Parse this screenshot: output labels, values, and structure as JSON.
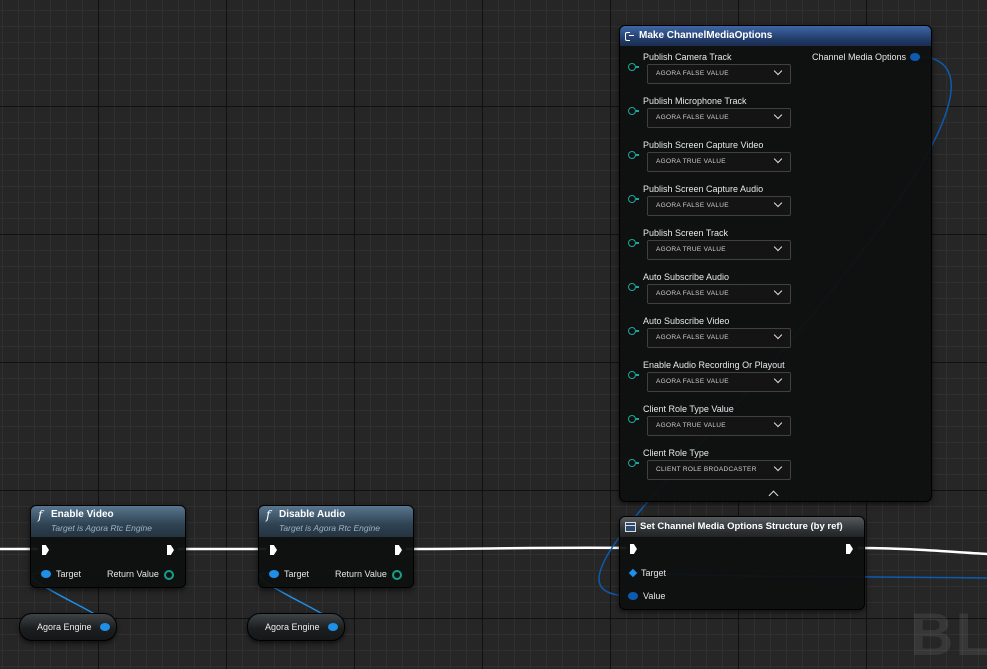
{
  "watermark": "BLU",
  "enable_video": {
    "title": "Enable Video",
    "subtitle": "Target is Agora Rtc Engine",
    "target_label": "Target",
    "return_label": "Return Value"
  },
  "disable_audio": {
    "title": "Disable Audio",
    "subtitle": "Target is Agora Rtc Engine",
    "target_label": "Target",
    "return_label": "Return Value"
  },
  "agora_engine_vars": [
    {
      "label": "Agora Engine"
    },
    {
      "label": "Agora Engine"
    }
  ],
  "make_node": {
    "title": "Make ChannelMediaOptions",
    "output_label": "Channel Media Options",
    "fields": [
      {
        "label": "Publish Camera Track",
        "value": "AGORA FALSE VALUE"
      },
      {
        "label": "Publish Microphone Track",
        "value": "AGORA FALSE VALUE"
      },
      {
        "label": "Publish Screen Capture Video",
        "value": "AGORA TRUE VALUE"
      },
      {
        "label": "Publish Screen Capture Audio",
        "value": "AGORA FALSE VALUE"
      },
      {
        "label": "Publish Screen Track",
        "value": "AGORA TRUE VALUE"
      },
      {
        "label": "Auto Subscribe Audio",
        "value": "AGORA FALSE VALUE"
      },
      {
        "label": "Auto Subscribe Video",
        "value": "AGORA FALSE VALUE"
      },
      {
        "label": "Enable Audio Recording Or Playout",
        "value": "AGORA FALSE VALUE"
      },
      {
        "label": "Client Role Type Value",
        "value": "AGORA TRUE VALUE"
      },
      {
        "label": "Client Role Type",
        "value": "CLIENT ROLE BROADCASTER"
      }
    ]
  },
  "set_node": {
    "title": "Set Channel Media Options Structure (by ref)",
    "target_label": "Target",
    "value_label": "Value"
  },
  "colors": {
    "exec_wire": "#ffffff",
    "object_wire": "#1f8fe8",
    "struct_wire": "#0c5bb0",
    "function_header": "#3f5a70",
    "make_header": "#2e5090"
  }
}
